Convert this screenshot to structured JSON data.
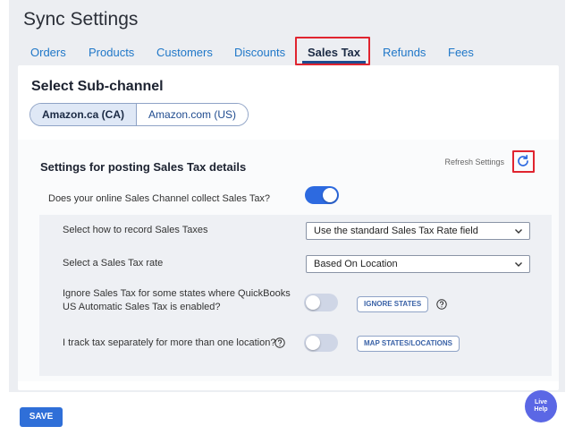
{
  "page": {
    "title": "Sync Settings"
  },
  "tabs": [
    {
      "label": "Orders"
    },
    {
      "label": "Products"
    },
    {
      "label": "Customers"
    },
    {
      "label": "Discounts"
    },
    {
      "label": "Sales Tax",
      "active": true
    },
    {
      "label": "Refunds"
    },
    {
      "label": "Fees"
    }
  ],
  "subchannel": {
    "title": "Select Sub-channel",
    "options": [
      {
        "label": "Amazon.ca (CA)",
        "selected": true
      },
      {
        "label": "Amazon.com (US)",
        "selected": false
      }
    ]
  },
  "section": {
    "title": "Settings for posting Sales Tax details",
    "refresh_label": "Refresh Settings",
    "refresh_icon": "refresh-icon",
    "collect_question": "Does your online Sales Channel collect Sales Tax?",
    "collect_enabled": true
  },
  "settings": {
    "record_label": "Select how to record Sales Taxes",
    "record_value": "Use the standard Sales Tax Rate field",
    "rate_label": "Select a Sales Tax rate",
    "rate_value": "Based On Location",
    "ignore_label_line1": "Ignore Sales Tax for some states where QuickBooks",
    "ignore_label_line2": "US Automatic Sales Tax is enabled?",
    "ignore_enabled": false,
    "ignore_button": "IGNORE STATES",
    "track_label": "I track tax separately for more than one location?",
    "track_enabled": false,
    "track_button": "MAP STATES/LOCATIONS"
  },
  "footer": {
    "save_label": "SAVE"
  },
  "live_help": {
    "line1": "Live",
    "line2": "Help"
  },
  "colors": {
    "accent": "#2d6ae0",
    "highlight": "#e0242f",
    "link": "#1f77c8"
  }
}
